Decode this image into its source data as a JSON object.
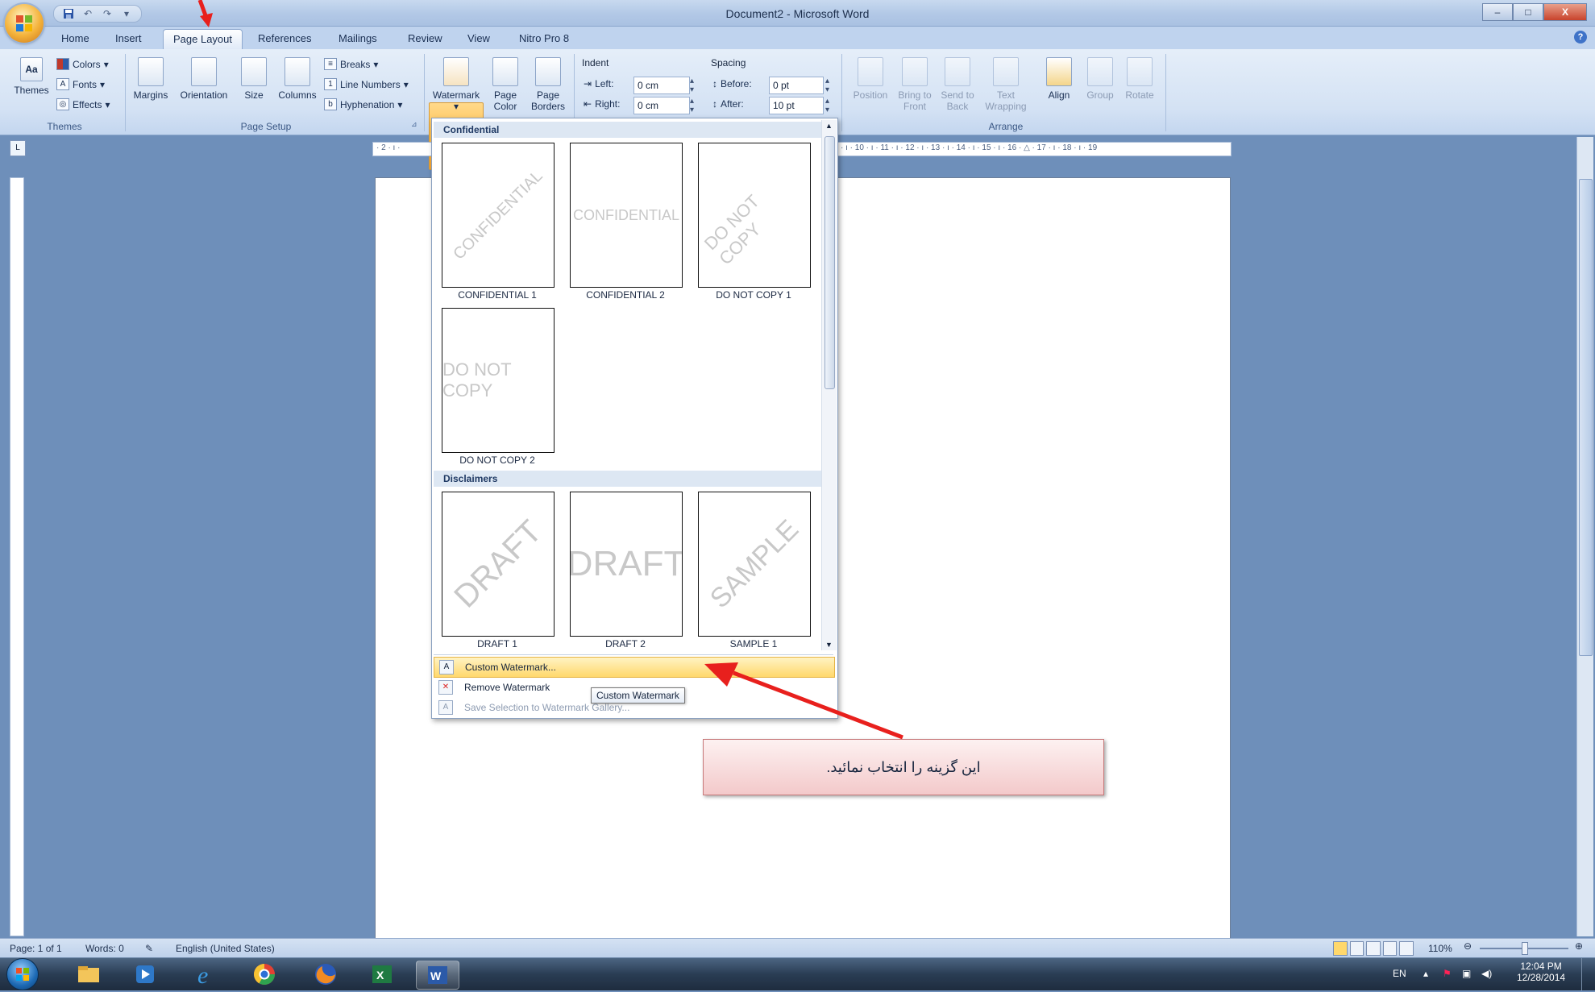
{
  "window": {
    "title": "Document2 - Microsoft Word",
    "buttons": [
      "–",
      "□",
      "X"
    ]
  },
  "tabs": [
    {
      "label": "Home"
    },
    {
      "label": "Insert"
    },
    {
      "label": "Page Layout"
    },
    {
      "label": "References"
    },
    {
      "label": "Mailings"
    },
    {
      "label": "Review"
    },
    {
      "label": "View"
    },
    {
      "label": "Nitro Pro 8"
    }
  ],
  "ribbon": {
    "themes": {
      "group_label": "Themes",
      "themes_label": "Themes",
      "colors_label": "Colors",
      "fonts_label": "Fonts",
      "effects_label": "Effects"
    },
    "page_setup": {
      "group_label": "Page Setup",
      "margins": "Margins",
      "orientation": "Orientation",
      "size": "Size",
      "columns": "Columns",
      "breaks": "Breaks",
      "line_numbers": "Line Numbers",
      "hyphenation": "Hyphenation"
    },
    "page_background": {
      "watermark": "Watermark",
      "page_color_1": "Page",
      "page_color_2": "Color",
      "page_borders_1": "Page",
      "page_borders_2": "Borders"
    },
    "paragraph": {
      "indent_label": "Indent",
      "left_label": "Left:",
      "left_value": "0 cm",
      "right_label": "Right:",
      "right_value": "0 cm",
      "spacing_label": "Spacing",
      "before_label": "Before:",
      "before_value": "0 pt",
      "after_label": "After:",
      "after_value": "10 pt"
    },
    "arrange": {
      "group_label": "Arrange",
      "position": "Position",
      "bring_to_front_1": "Bring to",
      "bring_to_front_2": "Front",
      "send_to_back_1": "Send to",
      "send_to_back_2": "Back",
      "text_wrapping_1": "Text",
      "text_wrapping_2": "Wrapping",
      "align": "Align",
      "group": "Group",
      "rotate": "Rotate"
    }
  },
  "ruler": {
    "numbers_left": "· 2 · ı ·",
    "numbers_right": "· ı · 10 · ı · 11 · ı · 12 · ı · 13 · ı · 14 · ı · 15 · ı · 16 · △ · 17 · ı · 18 · ı · 19"
  },
  "gallery": {
    "sections": [
      {
        "title": "Confidential",
        "items": [
          {
            "caption": "CONFIDENTIAL 1",
            "mark": "CONFIDENTIAL"
          },
          {
            "caption": "CONFIDENTIAL 2",
            "mark": "CONFIDENTIAL"
          },
          {
            "caption": "DO NOT COPY 1",
            "mark": "DO NOT COPY"
          },
          {
            "caption": "DO NOT COPY 2",
            "mark": "DO NOT COPY"
          }
        ]
      },
      {
        "title": "Disclaimers",
        "items": [
          {
            "caption": "DRAFT 1",
            "mark": "DRAFT"
          },
          {
            "caption": "DRAFT 2",
            "mark": "DRAFT"
          },
          {
            "caption": "SAMPLE 1",
            "mark": "SAMPLE"
          }
        ]
      }
    ],
    "menu": [
      {
        "label": "Custom Watermark...",
        "highlighted": true
      },
      {
        "label": "Remove Watermark"
      },
      {
        "label": "Save Selection to Watermark Gallery...",
        "disabled": true
      }
    ],
    "tooltip": "Custom Watermark"
  },
  "callout": {
    "text": "این گزینه را انتخاب نمائید."
  },
  "statusbar": {
    "page": "Page: 1 of 1",
    "words": "Words: 0",
    "language": "English (United States)",
    "zoom": "110%"
  },
  "taskbar": {
    "lang": "EN",
    "time": "12:04 PM",
    "date": "12/28/2014"
  },
  "colors": {
    "accent_red": "#e8201d",
    "highlight": "#ffd86c",
    "ribbon": "#d4e2f4"
  }
}
